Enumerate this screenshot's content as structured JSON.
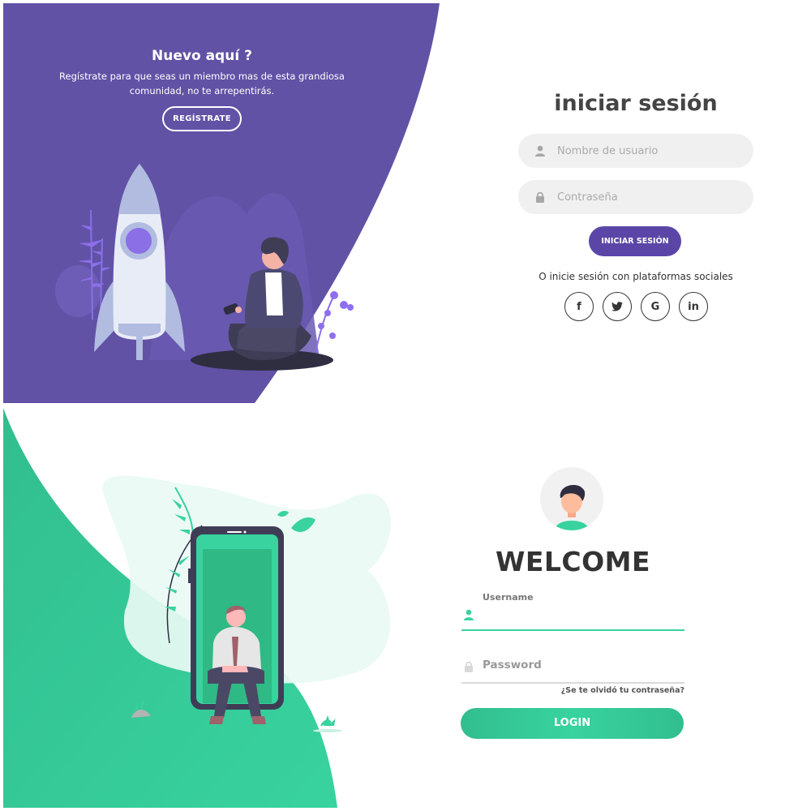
{
  "register_screen": {
    "colors": {
      "primary": "#6152a6",
      "accent": "#5b46a8"
    },
    "overlay": {
      "title": "Nuevo aquí ?",
      "text": "Regístrate para que seas un miembro mas de esta grandiosa comunidad, no te arrepentirás.",
      "button_label": "REGÍSTRATE"
    },
    "form": {
      "title": "iniciar sesión",
      "username_placeholder": "Nombre de usuario",
      "password_placeholder": "Contraseña",
      "submit_label": "INICIAR SESIÓN",
      "social_text": "O inicie sesión con plataformas sociales",
      "social": [
        {
          "icon": "facebook-icon",
          "glyph": "f"
        },
        {
          "icon": "twitter-icon",
          "glyph": "t"
        },
        {
          "icon": "google-icon",
          "glyph": "G"
        },
        {
          "icon": "linkedin-icon",
          "glyph": "in"
        }
      ]
    }
  },
  "welcome_screen": {
    "colors": {
      "primary": "#38d39f",
      "dark": "#32be8f"
    },
    "title": "WELCOME",
    "username_label": "Username",
    "password_label": "Password",
    "forgot_link": "¿Se te olvidó tu contraseña?",
    "login_label": "LOGIN"
  }
}
